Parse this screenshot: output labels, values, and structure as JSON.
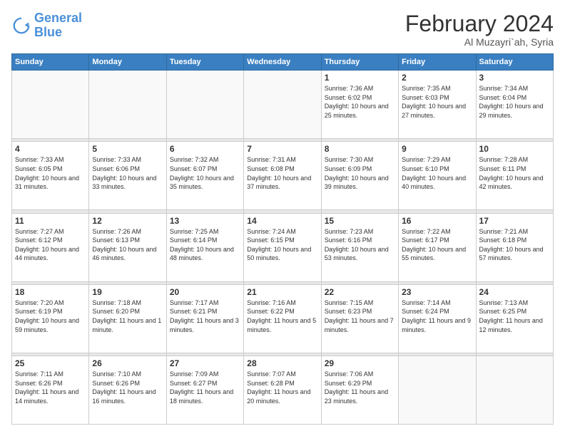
{
  "header": {
    "logo_line1": "General",
    "logo_line2": "Blue",
    "month": "February 2024",
    "location": "Al Muzayri`ah, Syria"
  },
  "days_of_week": [
    "Sunday",
    "Monday",
    "Tuesday",
    "Wednesday",
    "Thursday",
    "Friday",
    "Saturday"
  ],
  "weeks": [
    [
      {
        "day": "",
        "sunrise": "",
        "sunset": "",
        "daylight": ""
      },
      {
        "day": "",
        "sunrise": "",
        "sunset": "",
        "daylight": ""
      },
      {
        "day": "",
        "sunrise": "",
        "sunset": "",
        "daylight": ""
      },
      {
        "day": "",
        "sunrise": "",
        "sunset": "",
        "daylight": ""
      },
      {
        "day": "1",
        "sunrise": "Sunrise: 7:36 AM",
        "sunset": "Sunset: 6:02 PM",
        "daylight": "Daylight: 10 hours and 25 minutes."
      },
      {
        "day": "2",
        "sunrise": "Sunrise: 7:35 AM",
        "sunset": "Sunset: 6:03 PM",
        "daylight": "Daylight: 10 hours and 27 minutes."
      },
      {
        "day": "3",
        "sunrise": "Sunrise: 7:34 AM",
        "sunset": "Sunset: 6:04 PM",
        "daylight": "Daylight: 10 hours and 29 minutes."
      }
    ],
    [
      {
        "day": "4",
        "sunrise": "Sunrise: 7:33 AM",
        "sunset": "Sunset: 6:05 PM",
        "daylight": "Daylight: 10 hours and 31 minutes."
      },
      {
        "day": "5",
        "sunrise": "Sunrise: 7:33 AM",
        "sunset": "Sunset: 6:06 PM",
        "daylight": "Daylight: 10 hours and 33 minutes."
      },
      {
        "day": "6",
        "sunrise": "Sunrise: 7:32 AM",
        "sunset": "Sunset: 6:07 PM",
        "daylight": "Daylight: 10 hours and 35 minutes."
      },
      {
        "day": "7",
        "sunrise": "Sunrise: 7:31 AM",
        "sunset": "Sunset: 6:08 PM",
        "daylight": "Daylight: 10 hours and 37 minutes."
      },
      {
        "day": "8",
        "sunrise": "Sunrise: 7:30 AM",
        "sunset": "Sunset: 6:09 PM",
        "daylight": "Daylight: 10 hours and 39 minutes."
      },
      {
        "day": "9",
        "sunrise": "Sunrise: 7:29 AM",
        "sunset": "Sunset: 6:10 PM",
        "daylight": "Daylight: 10 hours and 40 minutes."
      },
      {
        "day": "10",
        "sunrise": "Sunrise: 7:28 AM",
        "sunset": "Sunset: 6:11 PM",
        "daylight": "Daylight: 10 hours and 42 minutes."
      }
    ],
    [
      {
        "day": "11",
        "sunrise": "Sunrise: 7:27 AM",
        "sunset": "Sunset: 6:12 PM",
        "daylight": "Daylight: 10 hours and 44 minutes."
      },
      {
        "day": "12",
        "sunrise": "Sunrise: 7:26 AM",
        "sunset": "Sunset: 6:13 PM",
        "daylight": "Daylight: 10 hours and 46 minutes."
      },
      {
        "day": "13",
        "sunrise": "Sunrise: 7:25 AM",
        "sunset": "Sunset: 6:14 PM",
        "daylight": "Daylight: 10 hours and 48 minutes."
      },
      {
        "day": "14",
        "sunrise": "Sunrise: 7:24 AM",
        "sunset": "Sunset: 6:15 PM",
        "daylight": "Daylight: 10 hours and 50 minutes."
      },
      {
        "day": "15",
        "sunrise": "Sunrise: 7:23 AM",
        "sunset": "Sunset: 6:16 PM",
        "daylight": "Daylight: 10 hours and 53 minutes."
      },
      {
        "day": "16",
        "sunrise": "Sunrise: 7:22 AM",
        "sunset": "Sunset: 6:17 PM",
        "daylight": "Daylight: 10 hours and 55 minutes."
      },
      {
        "day": "17",
        "sunrise": "Sunrise: 7:21 AM",
        "sunset": "Sunset: 6:18 PM",
        "daylight": "Daylight: 10 hours and 57 minutes."
      }
    ],
    [
      {
        "day": "18",
        "sunrise": "Sunrise: 7:20 AM",
        "sunset": "Sunset: 6:19 PM",
        "daylight": "Daylight: 10 hours and 59 minutes."
      },
      {
        "day": "19",
        "sunrise": "Sunrise: 7:18 AM",
        "sunset": "Sunset: 6:20 PM",
        "daylight": "Daylight: 11 hours and 1 minute."
      },
      {
        "day": "20",
        "sunrise": "Sunrise: 7:17 AM",
        "sunset": "Sunset: 6:21 PM",
        "daylight": "Daylight: 11 hours and 3 minutes."
      },
      {
        "day": "21",
        "sunrise": "Sunrise: 7:16 AM",
        "sunset": "Sunset: 6:22 PM",
        "daylight": "Daylight: 11 hours and 5 minutes."
      },
      {
        "day": "22",
        "sunrise": "Sunrise: 7:15 AM",
        "sunset": "Sunset: 6:23 PM",
        "daylight": "Daylight: 11 hours and 7 minutes."
      },
      {
        "day": "23",
        "sunrise": "Sunrise: 7:14 AM",
        "sunset": "Sunset: 6:24 PM",
        "daylight": "Daylight: 11 hours and 9 minutes."
      },
      {
        "day": "24",
        "sunrise": "Sunrise: 7:13 AM",
        "sunset": "Sunset: 6:25 PM",
        "daylight": "Daylight: 11 hours and 12 minutes."
      }
    ],
    [
      {
        "day": "25",
        "sunrise": "Sunrise: 7:11 AM",
        "sunset": "Sunset: 6:26 PM",
        "daylight": "Daylight: 11 hours and 14 minutes."
      },
      {
        "day": "26",
        "sunrise": "Sunrise: 7:10 AM",
        "sunset": "Sunset: 6:26 PM",
        "daylight": "Daylight: 11 hours and 16 minutes."
      },
      {
        "day": "27",
        "sunrise": "Sunrise: 7:09 AM",
        "sunset": "Sunset: 6:27 PM",
        "daylight": "Daylight: 11 hours and 18 minutes."
      },
      {
        "day": "28",
        "sunrise": "Sunrise: 7:07 AM",
        "sunset": "Sunset: 6:28 PM",
        "daylight": "Daylight: 11 hours and 20 minutes."
      },
      {
        "day": "29",
        "sunrise": "Sunrise: 7:06 AM",
        "sunset": "Sunset: 6:29 PM",
        "daylight": "Daylight: 11 hours and 23 minutes."
      },
      {
        "day": "",
        "sunrise": "",
        "sunset": "",
        "daylight": ""
      },
      {
        "day": "",
        "sunrise": "",
        "sunset": "",
        "daylight": ""
      }
    ]
  ]
}
